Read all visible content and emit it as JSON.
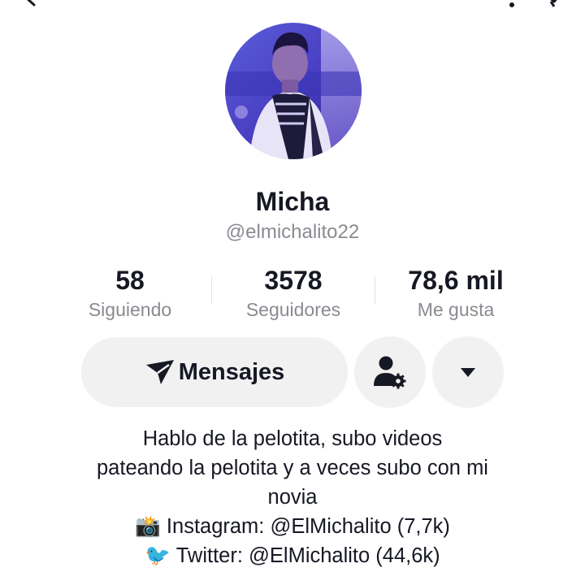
{
  "profile": {
    "name": "Micha",
    "handle": "@elmichalito22"
  },
  "stats": [
    {
      "value": "58",
      "label": "Siguiendo"
    },
    {
      "value": "3578",
      "label": "Seguidores"
    },
    {
      "value": "78,6 mil",
      "label": "Me gusta"
    }
  ],
  "actions": {
    "message_label": "Mensajes"
  },
  "bio": {
    "lines": [
      "Hablo de la pelotita, subo videos",
      "pateando la pelotita y a veces subo con mi",
      "novia"
    ],
    "instagram_emoji": "📸",
    "instagram_text": "Instagram: @ElMichalito (7,7k)",
    "twitter_emoji": "🐦",
    "twitter_text": "Twitter: @ElMichalito (44,6k)"
  },
  "icons": {
    "top_left": "back-arrow-icon",
    "top_right": [
      "bell-icon",
      "share-icon"
    ],
    "message": "send-icon",
    "friends": "person-settings-icon",
    "more": "caret-down-icon"
  },
  "colors": {
    "text_primary": "#161823",
    "text_secondary": "#8a8b91",
    "button_bg": "#f1f1f2"
  }
}
